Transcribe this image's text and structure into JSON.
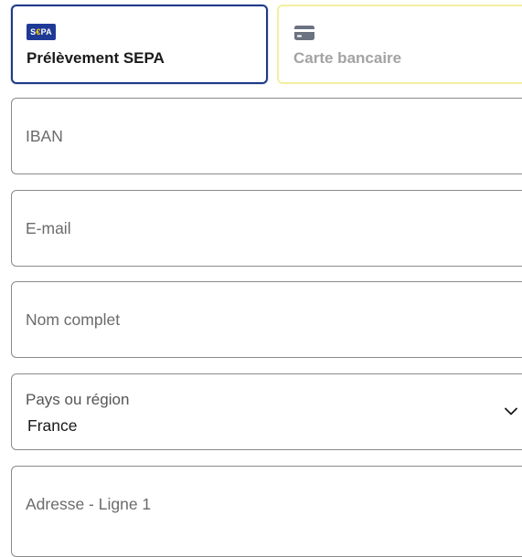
{
  "payment_methods": {
    "sepa": {
      "logo_text_prefix": "S",
      "logo_text_euro": "€",
      "logo_text_suffix": "PA",
      "icon": "sepa-logo-icon",
      "label": "Prélèvement SEPA",
      "selected": true
    },
    "card": {
      "icon": "credit-card-icon",
      "label": "Carte bancaire",
      "selected": false
    }
  },
  "form": {
    "iban": {
      "placeholder": "IBAN"
    },
    "email": {
      "placeholder": "E-mail"
    },
    "full_name": {
      "placeholder": "Nom complet"
    },
    "country": {
      "label": "Pays ou région",
      "value": "France",
      "icon": "chevron-down-icon"
    },
    "address_line1": {
      "placeholder": "Adresse - Ligne 1"
    }
  },
  "colors": {
    "selected_border": "#1e3a8a",
    "unselected_border": "#f4ef9e",
    "field_border": "#8a8a8a",
    "sepa_logo_bg": "#1f3a96"
  }
}
